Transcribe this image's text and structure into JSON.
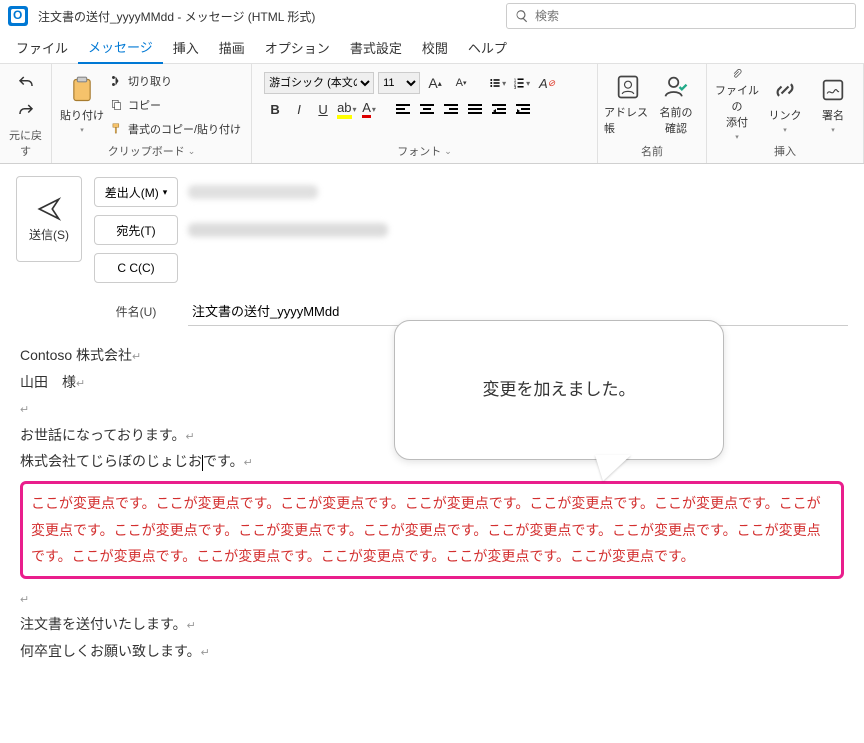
{
  "title": "注文書の送付_yyyyMMdd  -  メッセージ (HTML 形式)",
  "search": {
    "placeholder": "検索"
  },
  "menu": {
    "file": "ファイル",
    "message": "メッセージ",
    "insert": "挿入",
    "draw": "描画",
    "options": "オプション",
    "format": "書式設定",
    "review": "校閲",
    "help": "ヘルプ"
  },
  "ribbon": {
    "undo_label": "元に戻す",
    "clipboard": {
      "paste": "貼り付け",
      "cut": "切り取り",
      "copy": "コピー",
      "format_painter": "書式のコピー/貼り付け",
      "label": "クリップボード"
    },
    "font": {
      "name": "游ゴシック (本文の",
      "size": "11",
      "label": "フォント"
    },
    "names": {
      "address_book": "アドレス帳",
      "check_names": "名前の\n確認",
      "label": "名前"
    },
    "insert": {
      "attach_file": "ファイルの\n添付",
      "link": "リンク",
      "signature": "署名",
      "label": "挿入"
    }
  },
  "compose": {
    "send": "送信(S)",
    "from": "差出人(M)",
    "to": "宛先(T)",
    "cc": "C C(C)",
    "subject_label": "件名(U)",
    "subject_value": "注文書の送付_yyyyMMdd"
  },
  "body": {
    "l1": "Contoso 株式会社",
    "l2": "山田　様",
    "l3": "お世話になっております。",
    "l4a": "株式会社てじらぼのじょじお",
    "l4b": "です。",
    "changes": "ここが変更点です。ここが変更点です。ここが変更点です。ここが変更点です。ここが変更点です。ここが変更点です。ここが変更点です。ここが変更点です。ここが変更点です。ここが変更点です。ここが変更点です。ここが変更点です。ここが変更点です。ここが変更点です。ここが変更点です。ここが変更点です。ここが変更点です。ここが変更点です。",
    "l5": "注文書を送付いたします。",
    "l6": "何卒宜しくお願い致します。"
  },
  "callout": "変更を加えました。"
}
